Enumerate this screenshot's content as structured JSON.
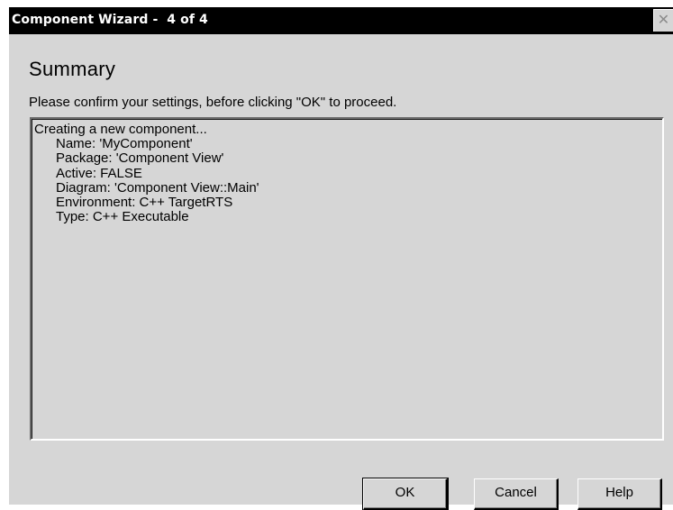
{
  "window": {
    "title": "Component Wizard -  4 of 4",
    "close_glyph": "✕",
    "close_icon": "close-icon"
  },
  "page": {
    "heading": "Summary",
    "instruction": "Please confirm your settings, before clicking \"OK\" to proceed."
  },
  "summary": {
    "lines": [
      "Creating a new component...",
      "Name: 'MyComponent'",
      "Package: 'Component View'",
      "Active: FALSE",
      "Diagram: 'Component View::Main'",
      "Environment: C++ TargetRTS",
      "Type: C++ Executable"
    ]
  },
  "buttons": {
    "ok": "OK",
    "cancel": "Cancel",
    "help": "Help"
  },
  "colors": {
    "title_bar": "#000000",
    "title_text": "#ffffff",
    "dialog_face": "#d6d6d6"
  }
}
